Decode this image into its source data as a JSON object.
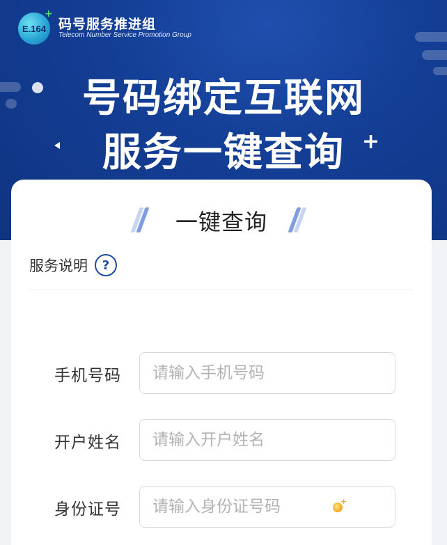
{
  "header": {
    "logo_text": "E.164",
    "org_name": "码号服务推进组",
    "org_subtitle": "Telecom Number Service Promotion Group"
  },
  "banner": {
    "line1": "号码绑定互联网",
    "line2": "服务一键查询"
  },
  "card": {
    "title": "一键查询",
    "service_label": "服务说明",
    "help_icon_glyph": "?"
  },
  "form": {
    "fields": [
      {
        "label": "手机号码",
        "placeholder": "请输入手机号码",
        "value": ""
      },
      {
        "label": "开户姓名",
        "placeholder": "请输入开户姓名",
        "value": ""
      },
      {
        "label": "身份证号",
        "placeholder": "请输入身份证号码",
        "value": ""
      }
    ]
  },
  "icons": {
    "logo": "e164-logo-icon",
    "help": "question-circle-icon",
    "sparkle": "sparkle-icon"
  },
  "colors": {
    "banner_bg": "#143f96",
    "accent": "#1e4aa0",
    "stripe_light": "#c7d5f2",
    "stripe_mid": "#7f9de0"
  }
}
